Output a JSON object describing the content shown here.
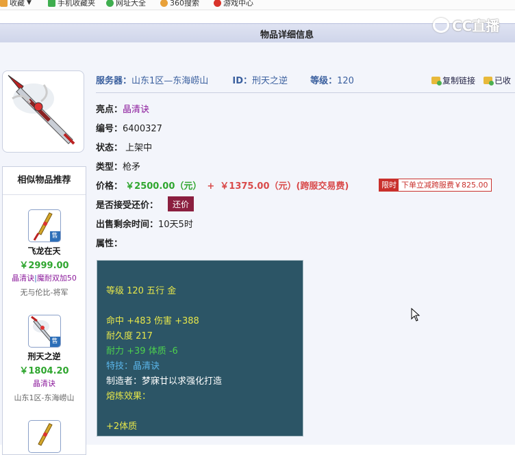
{
  "bookmarks": [
    {
      "label": "收藏",
      "icon": "star-icon",
      "color": "#e8a13a"
    },
    {
      "label": "手机收藏夹",
      "icon": "phone-icon",
      "color": "#3fae4f"
    },
    {
      "label": "网址大全",
      "icon": "plus-circle-icon",
      "color": "#3fae4f"
    },
    {
      "label": "360搜索",
      "icon": "search-360-icon",
      "color": "#e8a13a"
    },
    {
      "label": "游戏中心",
      "icon": "game-icon",
      "color": "#d9342b"
    }
  ],
  "page": {
    "title": "物品详细信息",
    "watermark": "CC直播"
  },
  "info": {
    "server_label": "服务器：",
    "server_value": "山东1区—东海崂山",
    "id_label": "ID：",
    "id_value": "刑天之逆",
    "level_label": "等级：",
    "level_value": "120",
    "copy_link": "复制链接",
    "collected": "已收"
  },
  "details": {
    "highlight_label": "亮点：",
    "highlight_value": "晶清诀",
    "number_label": "编号：",
    "number_value": "6400327",
    "status_label": "状态：",
    "status_value": "上架中",
    "type_label": "类型：",
    "type_value": "枪矛",
    "price_label": "价格：",
    "price_main": "￥2500.00（元）",
    "price_plus": "+",
    "price_fee": "￥1375.00（元）(跨服交易费)",
    "limit_tag": "限时",
    "limit_text": "下单立减跨服费￥825.00",
    "haggle_label": "是否接受还价：",
    "haggle_button": "还价",
    "time_label": "出售剩余时间：",
    "time_value": "10天5时",
    "attr_label": "属性："
  },
  "attributes": {
    "line1": "等级 120 五行 金",
    "line2": "命中 +483 伤害 +388",
    "line3": "耐久度 217",
    "line4": "耐力 +39 体质 -6",
    "line5": "特技：晶清诀",
    "line6": "制造者：梦寐廿以求强化打造",
    "line7": "熔炼效果：",
    "line8": "+2体质"
  },
  "similar": {
    "header": "相似物品推荐",
    "sale_tag": "售",
    "items": [
      {
        "name": "飞龙在天",
        "price": "￥2999.00",
        "attr1": "晶清诀",
        "sep": "|",
        "attr2": "魔耐双加50",
        "server": "无与伦比-将军"
      },
      {
        "name": "刑天之逆",
        "price": "￥1804.20",
        "attr1": "晶清诀",
        "sep": "",
        "attr2": "",
        "server": "山东1区-东海崂山"
      }
    ]
  }
}
